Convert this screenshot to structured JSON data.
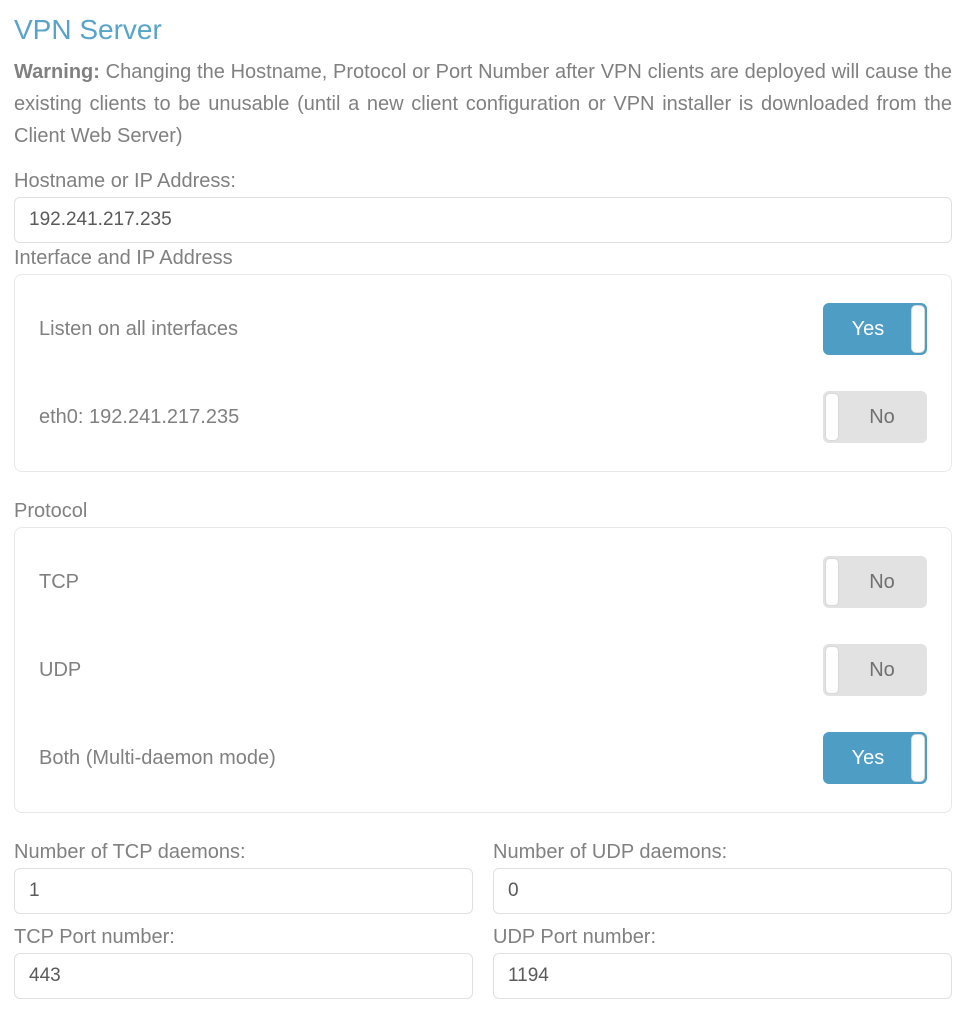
{
  "title": "VPN Server",
  "warning": {
    "label": "Warning:",
    "text": " Changing the Hostname, Protocol or Port Number after VPN clients are deployed will cause the existing clients to be unusable (until a new client configuration or VPN installer is downloaded from the Client Web Server)"
  },
  "hostname": {
    "label": "Hostname or IP Address:",
    "value": "192.241.217.235"
  },
  "interface": {
    "label": "Interface and IP Address",
    "options": [
      {
        "label": "Listen on all interfaces",
        "on": true,
        "text": "Yes"
      },
      {
        "label": "eth0: 192.241.217.235",
        "on": false,
        "text": "No"
      }
    ]
  },
  "protocol": {
    "label": "Protocol",
    "options": [
      {
        "label": "TCP",
        "on": false,
        "text": "No"
      },
      {
        "label": "UDP",
        "on": false,
        "text": "No"
      },
      {
        "label": "Both (Multi-daemon mode)",
        "on": true,
        "text": "Yes"
      }
    ]
  },
  "daemons": {
    "tcp_count_label": "Number of TCP daemons:",
    "tcp_count_value": "1",
    "udp_count_label": "Number of UDP daemons:",
    "udp_count_value": "0",
    "tcp_port_label": "TCP Port number:",
    "tcp_port_value": "443",
    "udp_port_label": "UDP Port number:",
    "udp_port_value": "1194"
  }
}
